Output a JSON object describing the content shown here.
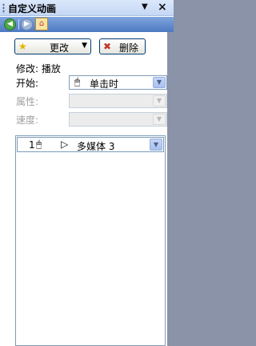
{
  "panel": {
    "title": "自定义动画"
  },
  "nav": {
    "back": "◀",
    "forward": "▶",
    "home": "⌂"
  },
  "actions": {
    "change_label": "更改",
    "remove_label": "删除"
  },
  "modify": {
    "label": "修改: 播放"
  },
  "fields": {
    "start": {
      "label": "开始:",
      "value": "单击时"
    },
    "property": {
      "label": "属性:",
      "value": ""
    },
    "speed": {
      "label": "速度:",
      "value": ""
    }
  },
  "list": {
    "items": [
      {
        "index": "1",
        "name": "多媒体 3"
      }
    ]
  },
  "colors": {
    "titlebar": "#c4d7f4",
    "navbar": "#4d79c2",
    "button_border": "#003c74"
  }
}
